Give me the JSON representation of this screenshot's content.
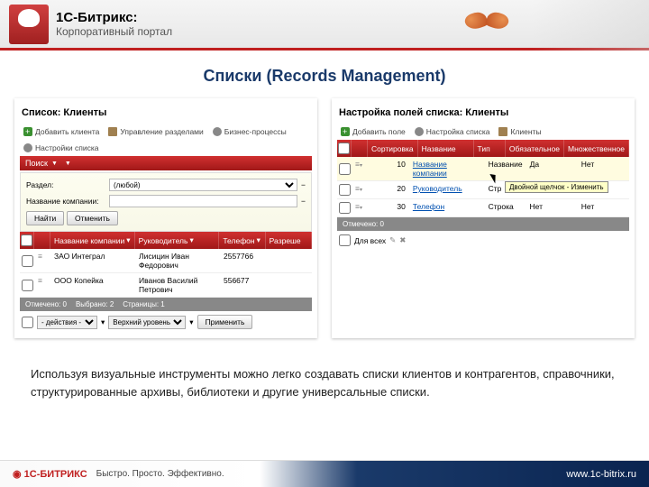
{
  "header": {
    "brand": "1С-Битрикс:",
    "subtitle": "Корпоративный портал"
  },
  "page_title": "Списки (Records Management)",
  "left_panel": {
    "title": "Список: Клиенты",
    "toolbar": [
      {
        "label": "Добавить клиента",
        "icon": "add"
      },
      {
        "label": "Управление разделами",
        "icon": "doc"
      },
      {
        "label": "Бизнес-процессы",
        "icon": "gear"
      },
      {
        "label": "Настройки списка",
        "icon": "gear"
      }
    ],
    "search_label": "Поиск",
    "filters": {
      "section_label": "Раздел:",
      "section_value": "(любой)",
      "company_label": "Название компании:"
    },
    "buttons": {
      "find": "Найти",
      "cancel": "Отменить"
    },
    "columns": [
      "Название компании",
      "Руководитель",
      "Телефон",
      "Разреше"
    ],
    "rows": [
      {
        "company": "ЗАО Интеграл",
        "manager": "Лисицин Иван Федорович",
        "phone": "2557766"
      },
      {
        "company": "ООО Копейка",
        "manager": "Иванов Василий Петрович",
        "phone": "556677"
      }
    ],
    "stats": {
      "marked": "Отмечено: 0",
      "selected": "Выбрано: 2",
      "pages": "Страницы: 1"
    },
    "bottom": {
      "action_opt": "- действия -",
      "level_opt": "Верхний уровень",
      "apply": "Применить"
    }
  },
  "right_panel": {
    "title": "Настройка полей списка: Клиенты",
    "toolbar": [
      {
        "label": "Добавить поле",
        "icon": "add"
      },
      {
        "label": "Настройка списка",
        "icon": "gear"
      },
      {
        "label": "Клиенты",
        "icon": "doc"
      }
    ],
    "columns": [
      "Сортировка",
      "Название",
      "Тип",
      "Обязательное",
      "Множественное"
    ],
    "rows": [
      {
        "sort": "10",
        "name": "Название компании",
        "type": "Название",
        "req": "Да",
        "multi": "Нет"
      },
      {
        "sort": "20",
        "name": "Руководитель",
        "type": "Стр",
        "req": "",
        "multi": "Нет"
      },
      {
        "sort": "30",
        "name": "Телефон",
        "type": "Строка",
        "req": "Нет",
        "multi": "Нет"
      }
    ],
    "tooltip": "Двойной щелчок - Изменить",
    "stats": "Отмечено: 0",
    "bottom": {
      "for_all": "Для всех"
    }
  },
  "description": "Используя визуальные инструменты можно легко создавать списки клиентов и контрагентов, справочники, структурированные архивы, библиотеки и другие универсальные списки.",
  "footer": {
    "logo": "1С-БИТРИКС",
    "slogan": "Быстро. Просто. Эффективно.",
    "url": "www.1c-bitrix.ru"
  }
}
